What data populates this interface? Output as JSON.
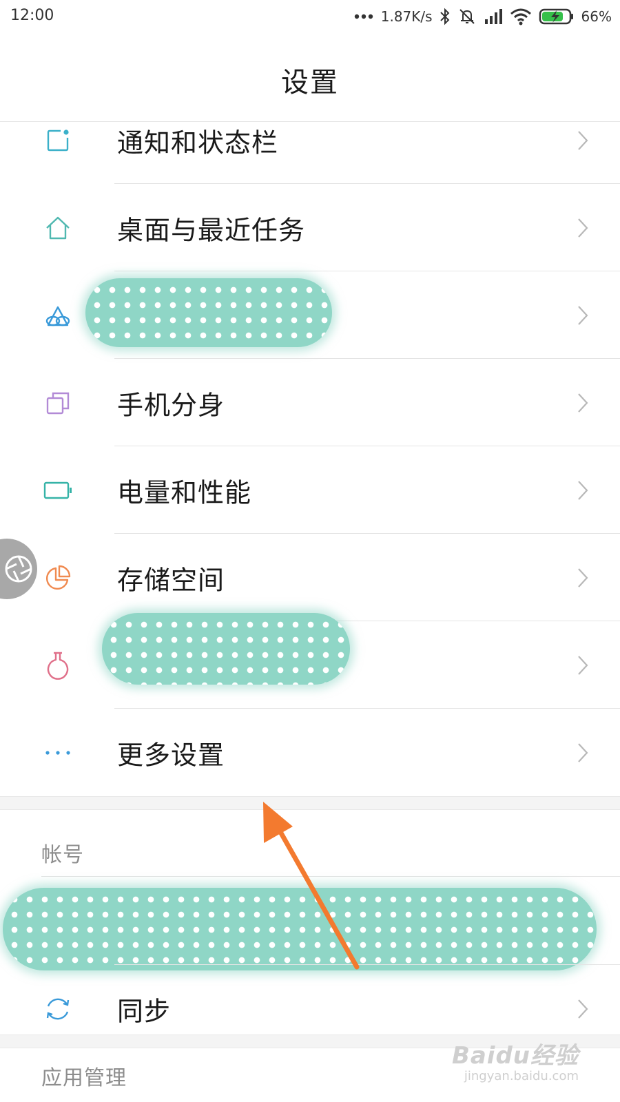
{
  "status_bar": {
    "time": "12:00",
    "more_icon": "ellipsis-icon",
    "net_speed": "1.87K/s",
    "battery_percent": "66%",
    "icons": [
      "bluetooth-icon",
      "silent-icon",
      "signal-icon",
      "wifi-icon",
      "battery-charging-icon"
    ]
  },
  "header": {
    "title": "设置"
  },
  "settings": {
    "items": [
      {
        "label": "通知和状态栏",
        "icon": "notification-icon",
        "icon_color": "#3bb0c9"
      },
      {
        "label": "桌面与最近任务",
        "icon": "home-icon",
        "icon_color": "#4fb8b0"
      },
      {
        "label": "",
        "icon": "theme-icon",
        "icon_color": "#3a9ad9",
        "redacted": true
      },
      {
        "label": "手机分身",
        "icon": "second-space-icon",
        "icon_color": "#b28ad6"
      },
      {
        "label": "电量和性能",
        "icon": "battery-icon",
        "icon_color": "#35b3a7"
      },
      {
        "label": "存储空间",
        "icon": "storage-icon",
        "icon_color": "#f08a50"
      },
      {
        "label": "",
        "icon": "lab-flask-icon",
        "icon_color": "#e0708a",
        "redacted": true
      },
      {
        "label": "更多设置",
        "icon": "more-dots-icon",
        "icon_color": "#3a9ad9"
      }
    ]
  },
  "account_section": {
    "header": "帐号",
    "items": [
      {
        "label": "同步",
        "icon": "sync-icon",
        "icon_color": "#3a9ad9"
      }
    ]
  },
  "apps_section": {
    "header": "应用管理"
  },
  "annotation": {
    "arrow_color": "#f37a2f",
    "target": "更多设置"
  },
  "watermark": {
    "main": "Baidu经验",
    "sub": "jingyan.baidu.com"
  }
}
